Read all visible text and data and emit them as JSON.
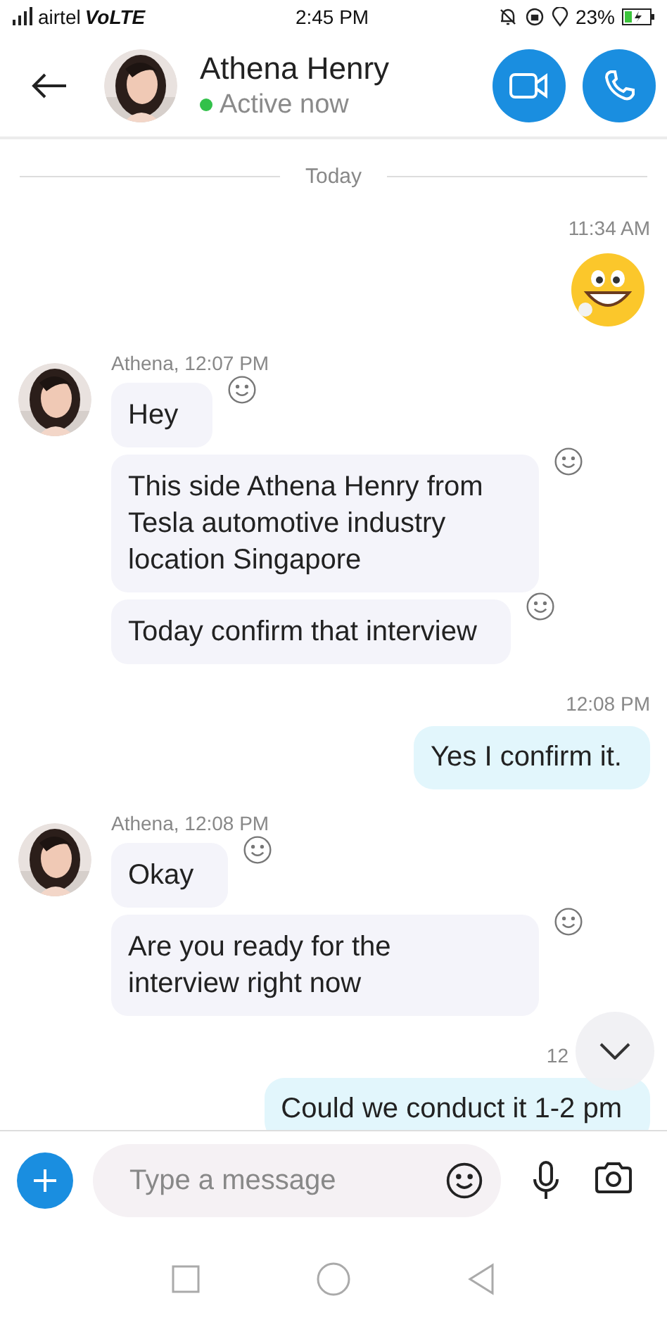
{
  "status_bar": {
    "carrier": "airtel",
    "network": "VoLTE",
    "time": "2:45 PM",
    "battery": "23%"
  },
  "header": {
    "name": "Athena Henry",
    "presence": "Active now",
    "online": true
  },
  "thread": [
    {
      "kind": "day",
      "text": "Today"
    },
    {
      "kind": "outgoing_emoji",
      "time": "11:34 AM"
    },
    {
      "kind": "incoming",
      "header": "Athena, 12:07 PM",
      "bubbles": [
        "Hey",
        "This side Athena Henry from Tesla automotive industry location Singapore",
        "Today confirm that interview"
      ]
    },
    {
      "kind": "outgoing",
      "time": "12:08 PM",
      "text": "Yes I confirm it."
    },
    {
      "kind": "incoming",
      "header": "Athena, 12:08 PM",
      "bubbles": [
        "Okay",
        "Are you ready for the interview right now"
      ]
    },
    {
      "kind": "outgoing",
      "time": "12",
      "text": "Could we conduct it 1-2 pm"
    }
  ],
  "composer": {
    "placeholder": "Type a message"
  }
}
